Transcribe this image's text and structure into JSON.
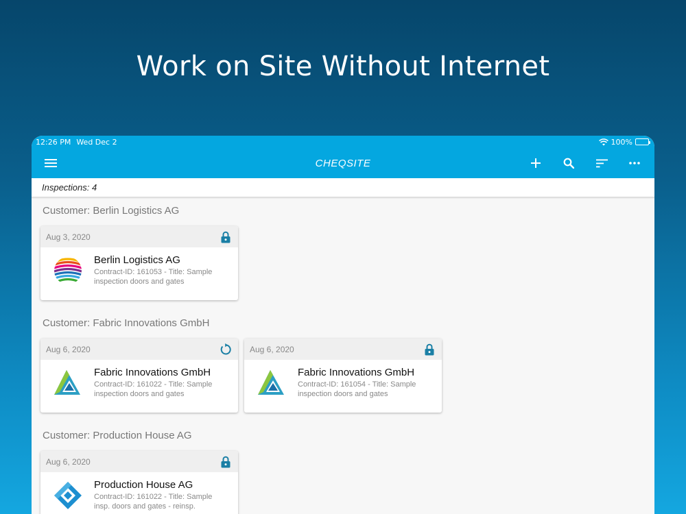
{
  "headline": "Work on Site Without Internet",
  "status_bar": {
    "time": "12:26 PM",
    "date": "Wed Dec 2",
    "battery": "100%"
  },
  "app": {
    "title": "CHEQSITE",
    "icons": {
      "menu": "hamburger-icon",
      "add": "plus-icon",
      "search": "search-icon",
      "sort": "sort-icon",
      "more": "more-horizontal-icon"
    }
  },
  "summary": {
    "label": "Inspections: 4"
  },
  "groups": [
    {
      "title": "Customer: Berlin Logistics AG",
      "cards": [
        {
          "date": "Aug 3, 2020",
          "status_icon": "lock-icon",
          "logo": "berlin-logistics-logo",
          "name": "Berlin Logistics AG",
          "desc_line1": "Contract-ID: 161053 - Title: Sample",
          "desc_line2": "inspection doors and gates"
        }
      ]
    },
    {
      "title": "Customer: Fabric Innovations GmbH",
      "cards": [
        {
          "date": "Aug 6, 2020",
          "status_icon": "sync-icon",
          "logo": "fabric-innovations-logo",
          "name": "Fabric Innovations GmbH",
          "desc_line1": "Contract-ID: 161022 - Title: Sample",
          "desc_line2": "inspection doors and gates"
        },
        {
          "date": "Aug 6, 2020",
          "status_icon": "lock-icon",
          "logo": "fabric-innovations-logo",
          "name": "Fabric Innovations GmbH",
          "desc_line1": "Contract-ID: 161054 - Title: Sample",
          "desc_line2": "inspection doors and gates"
        }
      ]
    },
    {
      "title": "Customer: Production House AG",
      "cards": [
        {
          "date": "Aug 6, 2020",
          "status_icon": "lock-icon",
          "logo": "production-house-logo",
          "name": "Production House AG",
          "desc_line1": "Contract-ID: 161022 - Title: Sample",
          "desc_line2": "insp. doors and gates - reinsp."
        }
      ]
    }
  ],
  "colors": {
    "accent": "#04a7e0",
    "icon_teal": "#1a7fa5"
  }
}
